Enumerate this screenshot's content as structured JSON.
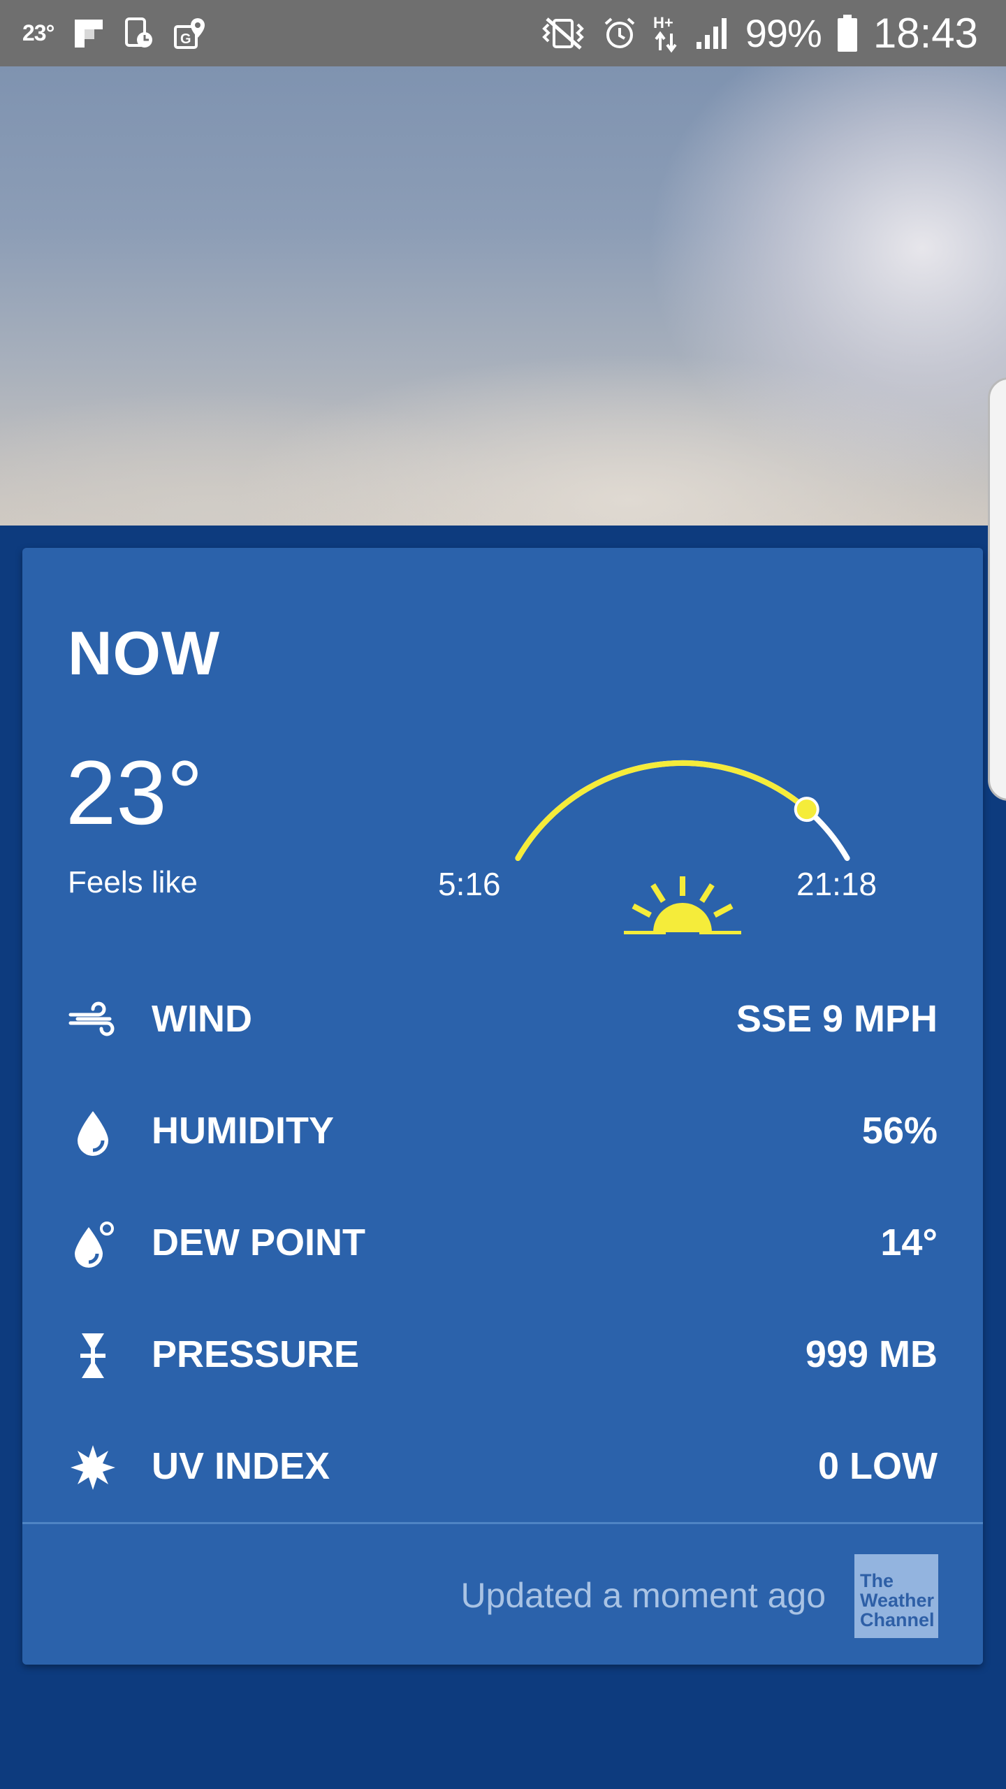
{
  "status_bar": {
    "temperature": "23°",
    "battery_percent": "99%",
    "time": "18:43",
    "network_type": "H+",
    "icons": [
      "flipboard-icon",
      "device-clock-icon",
      "google-maps-icon",
      "vibrate-icon",
      "alarm-icon",
      "data-arrows-icon",
      "signal-icon",
      "battery-icon"
    ]
  },
  "card": {
    "title": "NOW",
    "current_temp": "23°",
    "feels_like_label": "Feels like",
    "sunrise": "5:16",
    "sunset": "21:18",
    "sun_progress": 0.84,
    "arc_color": "#f5ec3a",
    "details": [
      {
        "icon": "wind-icon",
        "label": "WIND",
        "value": "SSE 9 MPH"
      },
      {
        "icon": "humidity-drop-icon",
        "label": "HUMIDITY",
        "value": "56%"
      },
      {
        "icon": "dew-point-icon",
        "label": "DEW POINT",
        "value": "14°"
      },
      {
        "icon": "pressure-icon",
        "label": "PRESSURE",
        "value": "999 MB"
      },
      {
        "icon": "uv-sun-icon",
        "label": "UV INDEX",
        "value": "0 LOW"
      }
    ],
    "updated_text": "Updated a moment ago",
    "logo": {
      "line1": "The",
      "line2": "Weather",
      "line3": "Channel"
    }
  },
  "colors": {
    "background": "#0d3b7e",
    "card": "#2b62ab",
    "status_bar": "#6f6f6f",
    "accent_yellow": "#f5ec3a"
  }
}
